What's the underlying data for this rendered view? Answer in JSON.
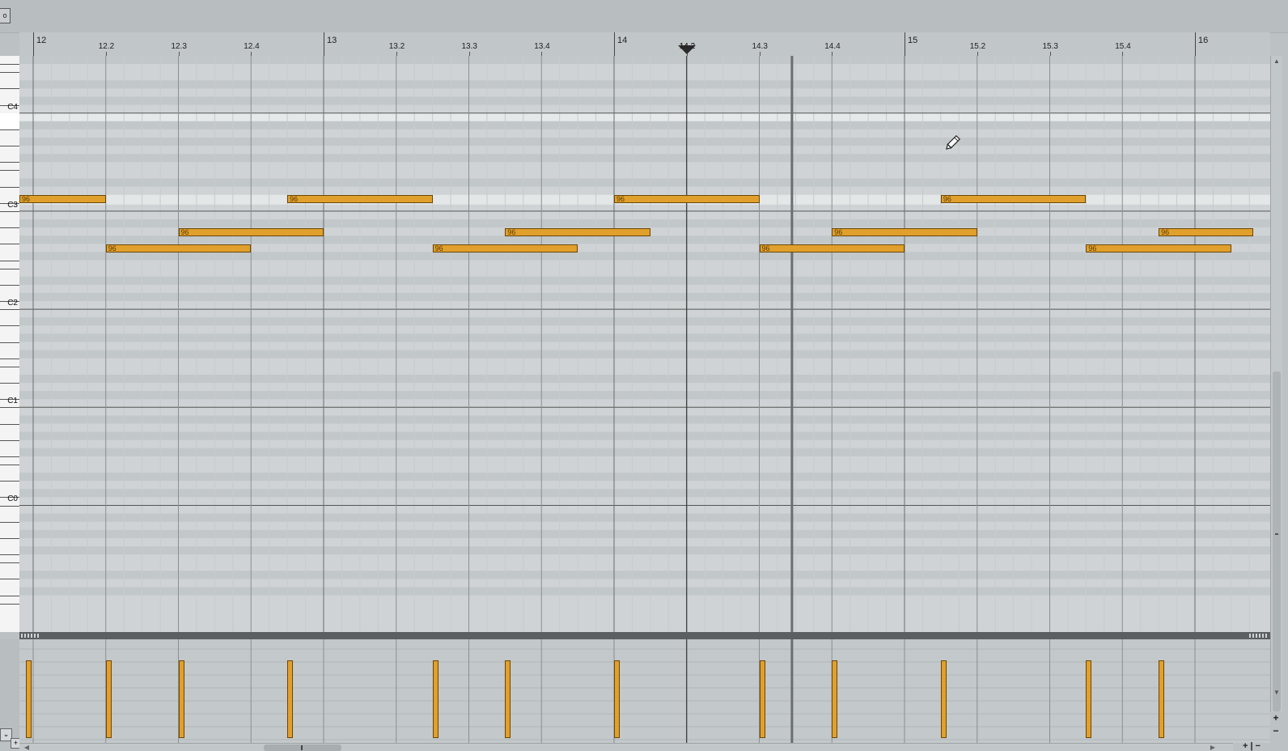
{
  "toolbar": {
    "corner_label": "o"
  },
  "ruler": {
    "major": [
      {
        "label": "12",
        "beat": 0
      },
      {
        "label": "13",
        "beat": 4
      },
      {
        "label": "14",
        "beat": 8
      },
      {
        "label": "15",
        "beat": 12
      },
      {
        "label": "16",
        "beat": 16
      }
    ],
    "minor": [
      {
        "label": "12.2",
        "beat": 1
      },
      {
        "label": "12.3",
        "beat": 2
      },
      {
        "label": "12.4",
        "beat": 3
      },
      {
        "label": "13.2",
        "beat": 5
      },
      {
        "label": "13.3",
        "beat": 6
      },
      {
        "label": "13.4",
        "beat": 7
      },
      {
        "label": "14.2",
        "beat": 9
      },
      {
        "label": "14.3",
        "beat": 10
      },
      {
        "label": "14.4",
        "beat": 11
      },
      {
        "label": "15.2",
        "beat": 13
      },
      {
        "label": "15.3",
        "beat": 14
      },
      {
        "label": "15.4",
        "beat": 15
      }
    ]
  },
  "playhead": {
    "position_beats": 9.0,
    "label": "14.2"
  },
  "loop_marker": {
    "position_beats": 10.45
  },
  "keyboard": {
    "octaves": [
      {
        "label": "C4",
        "midi": 60
      },
      {
        "label": "C3",
        "midi": 48
      },
      {
        "label": "C2",
        "midi": 36
      },
      {
        "label": "C1",
        "midi": 24
      },
      {
        "label": "C0",
        "midi": 12
      }
    ],
    "highlighted_midi": 59
  },
  "notes": [
    {
      "start": -0.2,
      "dur": 1.2,
      "pitch": 49,
      "velocity": "96"
    },
    {
      "start": 1.0,
      "dur": 2.0,
      "pitch": 43,
      "velocity": "96"
    },
    {
      "start": 2.0,
      "dur": 2.0,
      "pitch": 45,
      "velocity": "96"
    },
    {
      "start": 3.5,
      "dur": 2.0,
      "pitch": 49,
      "velocity": "96"
    },
    {
      "start": 5.5,
      "dur": 2.0,
      "pitch": 43,
      "velocity": "96"
    },
    {
      "start": 6.5,
      "dur": 2.0,
      "pitch": 45,
      "velocity": "96"
    },
    {
      "start": 8.0,
      "dur": 2.0,
      "pitch": 49,
      "velocity": "96"
    },
    {
      "start": 10.0,
      "dur": 2.0,
      "pitch": 43,
      "velocity": "96"
    },
    {
      "start": 11.0,
      "dur": 2.0,
      "pitch": 45,
      "velocity": "96"
    },
    {
      "start": 12.5,
      "dur": 2.0,
      "pitch": 49,
      "velocity": "96"
    },
    {
      "start": 14.5,
      "dur": 2.0,
      "pitch": 43,
      "velocity": "96"
    },
    {
      "start": 15.5,
      "dur": 1.3,
      "pitch": 45,
      "velocity": "96"
    }
  ],
  "velocity_lane": {
    "bars": [
      -0.1,
      1.0,
      2.0,
      3.5,
      5.5,
      6.5,
      8.0,
      10.0,
      11.0,
      12.5,
      14.5,
      15.5
    ]
  },
  "scroll": {
    "zoom_in": "+",
    "zoom_out": "−",
    "h_zoom": "+ | −",
    "lane_add": "+"
  }
}
